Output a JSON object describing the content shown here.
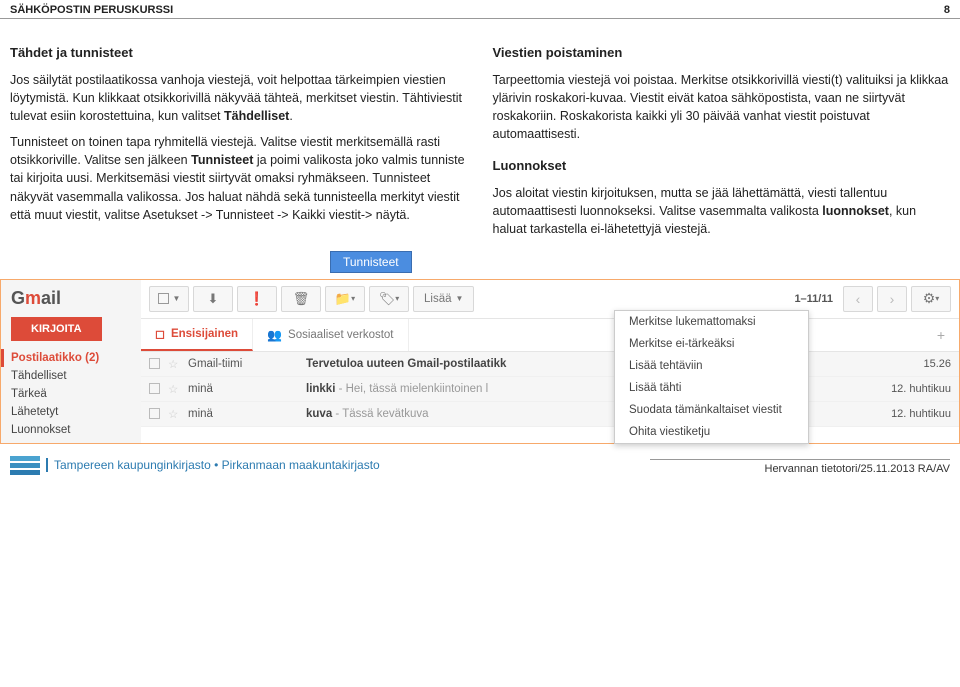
{
  "header": {
    "title": "SÄHKÖPOSTIN PERUSKURSSI",
    "page": "8"
  },
  "left": {
    "h": "Tähdet ja tunnisteet",
    "p1a": "Jos säilytät postilaatikossa vanhoja viestejä, voit helpottaa tärkeimpien viestien löytymistä. Kun klikkaat otsikkorivillä näkyvää tähteä, merkitset viestin. Tähtiviestit tulevat esiin korostettuina, kun valitset ",
    "p1b": "Tähdelliset",
    "p1c": ".",
    "p2a": "Tunnisteet on toinen tapa ryhmitellä viestejä. Valitse viestit merkitsemällä rasti otsikkoriville. Valitse sen jälkeen ",
    "p2b": "Tunnisteet",
    "p2c": " ja poimi valikosta joko valmis tunniste tai kirjoita uusi. Merkitsemäsi viestit siirtyvät omaksi ryhmäkseen. Tunnisteet näkyvät vasemmalla valikossa. Jos haluat nähdä sekä tunnisteella merkityt viestit että muut viestit, valitse Asetukset -> Tunnisteet -> Kaikki viestit-> näytä."
  },
  "right": {
    "h1": "Viestien poistaminen",
    "p1": "Tarpeettomia viestejä voi poistaa. Merkitse otsikkorivillä viesti(t) valituiksi ja klikkaa ylärivin roskakori-kuvaa. Viestit eivät katoa sähköpostista, vaan ne siirtyvät roskakoriin. Roskakorista kaikki yli 30 päivää vanhat viestit poistuvat automaattisesti.",
    "h2": "Luonnokset",
    "p2a": "Jos aloitat viestin kirjoituksen, mutta se jää lähettämättä, viesti tallentuu automaattisesti luonnokseksi. Valitse vasemmalta valikosta ",
    "p2b": "luonnokset",
    "p2c": ", kun haluat tarkastella ei-lähetettyjä viestejä."
  },
  "callout": "Tunnisteet",
  "gmail": {
    "logo1": "G",
    "logo2": "m",
    "logo3": "ail",
    "compose": "KIRJOITA",
    "sidebar": [
      "Postilaatikko (2)",
      "Tähdelliset",
      "Tärkeä",
      "Lähetetyt",
      "Luonnokset"
    ],
    "more": "Lisää",
    "pager": "1–11/11",
    "tabs": {
      "primary": "Ensisijainen",
      "social": "Sosiaaliset verkostot"
    },
    "dropdown": [
      "Merkitse lukemattomaksi",
      "Merkitse ei-tärkeäksi",
      "Lisää tehtäviin",
      "Lisää tähti",
      "Suodata tämänkaltaiset viestit",
      "Ohita viestiketju"
    ],
    "rows": [
      {
        "from": "Gmail-tiimi",
        "subj": "Tervetuloa uuteen Gmail-postilaatikk",
        "snippet": "",
        "date": "15.26"
      },
      {
        "from": "minä",
        "subj": "linkki",
        "snippet": " - Hei, tässä mielenkiintoinen l",
        "date": "12. huhtikuu"
      },
      {
        "from": "minä",
        "subj": "kuva",
        "snippet": " - Tässä kevätkuva",
        "date": "12. huhtikuu"
      }
    ]
  },
  "footer": {
    "org": "Tampereen kaupunginkirjasto • Pirkanmaan maakuntakirjasto",
    "src": "Hervannan tietotori/25.11.2013 RA/AV"
  }
}
